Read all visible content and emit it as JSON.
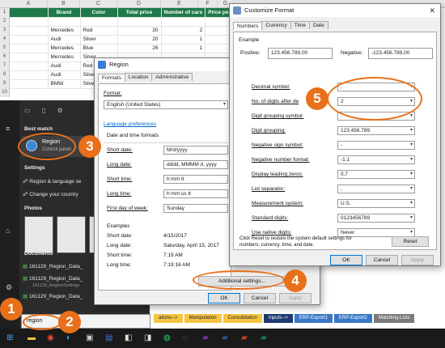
{
  "excel": {
    "columns": [
      "A",
      "B",
      "C",
      "D",
      "E",
      "F",
      "G"
    ],
    "row_numbers": [
      "1",
      "2",
      "3",
      "4",
      "5",
      "6",
      "7",
      "8",
      "9",
      "10"
    ],
    "headers": [
      "Brand",
      "Color",
      "Total price",
      "Number of cars",
      "Price per car"
    ],
    "rows": [
      [
        "Mercedes",
        "Red",
        "30",
        "2",
        "15"
      ],
      [
        "Audi",
        "Silver",
        "20",
        "1",
        "20"
      ],
      [
        "Mercedes",
        "Blue",
        "26",
        "1",
        "26"
      ],
      [
        "Mercedes",
        "Silver",
        "",
        "",
        ""
      ],
      [
        "Audi",
        "Red",
        "",
        "",
        ""
      ],
      [
        "Audi",
        "Silver",
        "",
        "",
        ""
      ],
      [
        "BMW",
        "Silver",
        "",
        "",
        ""
      ]
    ],
    "sheet_tabs": [
      "ations-->",
      "Manipulation",
      "Consolidation",
      "Inputs-->",
      "ERP-Export1",
      "ERP-Export2",
      "Matching-Lists"
    ]
  },
  "start_menu": {
    "best_match_heading": "Best match",
    "best_match_title": "Region",
    "best_match_subtitle": "Control panel",
    "settings_heading": "Settings",
    "settings_items": [
      "Region & language se",
      "Change your country"
    ],
    "photos_heading": "Photos",
    "documents_heading": "Documents",
    "documents": [
      "161129_Region_Data_",
      "161129_Region_Data_",
      "161129_Region_Data_"
    ],
    "document_sub": "161126_RegionSettings",
    "search_value": "region"
  },
  "region_dialog": {
    "title": "Region",
    "tabs": [
      "Formats",
      "Location",
      "Administrative"
    ],
    "format_label": "Format:",
    "format_value": "English (United States)",
    "language_link": "Language preferences",
    "date_time_heading": "Date and time formats",
    "fields": [
      {
        "label": "Short date:",
        "value": "M/d/yyyy"
      },
      {
        "label": "Long date:",
        "value": "dddd, MMMM d, yyyy"
      },
      {
        "label": "Short time:",
        "value": "h:mm tt"
      },
      {
        "label": "Long time:",
        "value": "h:mm:ss tt"
      },
      {
        "label": "First day of week:",
        "value": "Sunday"
      }
    ],
    "examples_heading": "Examples",
    "examples": [
      {
        "label": "Short date:",
        "value": "4/15/2017"
      },
      {
        "label": "Long date:",
        "value": "Saturday, April 15, 2017"
      },
      {
        "label": "Short time:",
        "value": "7:19 AM"
      },
      {
        "label": "Long time:",
        "value": "7:19:16 AM"
      }
    ],
    "additional_button": "Additional settings...",
    "ok": "OK",
    "cancel": "Cancel",
    "apply": "Apply"
  },
  "customize_dialog": {
    "title": "Customize Format",
    "tabs": [
      "Numbers",
      "Currency",
      "Time",
      "Date"
    ],
    "example_heading": "Example",
    "positive_label": "Positive:",
    "positive_value": "123.456.789,00",
    "negative_label": "Negative:",
    "negative_value": "-123.456.789,00",
    "settings": [
      {
        "label": "Decimal symbol:",
        "value": ","
      },
      {
        "label": "No. of digits after de",
        "value": "2"
      },
      {
        "label": "Digit grouping symbol:",
        "value": "."
      },
      {
        "label": "Digit grouping:",
        "value": "123.456.789"
      },
      {
        "label": "Negative sign symbol:",
        "value": "-"
      },
      {
        "label": "Negative number format:",
        "value": "-1,1"
      },
      {
        "label": "Display leading zeros:",
        "value": "0,7"
      },
      {
        "label": "List separator:",
        "value": ","
      },
      {
        "label": "Measurement system:",
        "value": "U.S."
      },
      {
        "label": "Standard digits:",
        "value": "0123456789"
      },
      {
        "label": "Use native digits:",
        "value": "Never"
      }
    ],
    "reset_note_1": "Click Reset to restore the system default settings for",
    "reset_note_2": "numbers, currency, time, and date.",
    "reset_button": "Reset",
    "ok": "OK",
    "cancel": "Cancel",
    "apply": "Apply"
  },
  "callouts": [
    "1",
    "2",
    "3",
    "4",
    "5"
  ],
  "colors": {
    "accent": "#e8701a",
    "excel_header": "#1f7a4a",
    "link": "#0066cc"
  }
}
